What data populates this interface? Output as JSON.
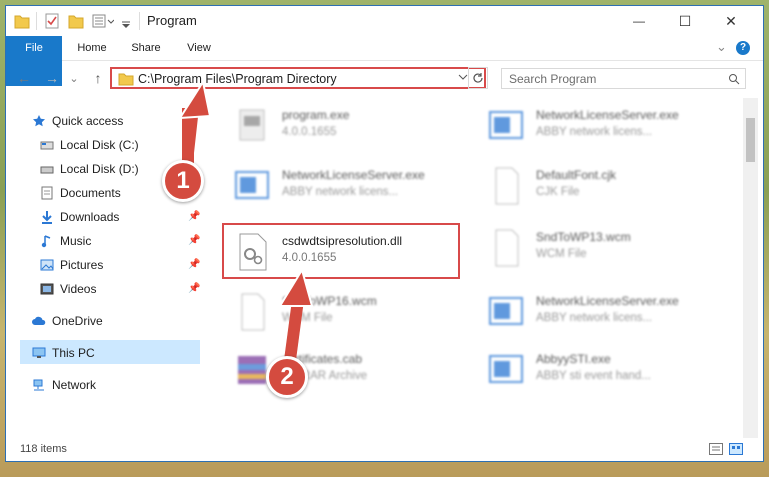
{
  "window": {
    "title": "Program",
    "min_glyph": "—",
    "max_glyph": "☐",
    "close_glyph": "✕"
  },
  "ribbon": {
    "tabs": [
      "File",
      "Home",
      "Share",
      "View"
    ],
    "expand_glyph": "⌄",
    "help_glyph": "?"
  },
  "nav_bar": {
    "back_glyph": "←",
    "forward_glyph": "→",
    "recent_glyph": "⌄",
    "up_glyph": "↑",
    "address": "C:\\Program Files\\Program Directory",
    "search_placeholder": "Search Program"
  },
  "sidebar": {
    "items": [
      {
        "label": "Quick access",
        "icon": "star-icon"
      },
      {
        "label": "Local Disk (C:)",
        "icon": "drive-icon"
      },
      {
        "label": "Local Disk (D:)",
        "icon": "drive-icon"
      },
      {
        "label": "Documents",
        "icon": "document-icon",
        "pinned": true
      },
      {
        "label": "Downloads",
        "icon": "download-icon",
        "pinned": true
      },
      {
        "label": "Music",
        "icon": "music-icon",
        "pinned": true
      },
      {
        "label": "Pictures",
        "icon": "picture-icon",
        "pinned": true
      },
      {
        "label": "Videos",
        "icon": "video-icon",
        "pinned": true
      },
      {
        "label": "OneDrive",
        "icon": "cloud-icon"
      },
      {
        "label": "This PC",
        "icon": "computer-icon",
        "selected": true
      },
      {
        "label": "Network",
        "icon": "network-icon"
      }
    ]
  },
  "files": {
    "left": [
      {
        "name": "program.exe",
        "meta": "4.0.0.1655"
      },
      {
        "name": "NetworkLicenseServer.exe",
        "meta": "ABBY network licens..."
      },
      {
        "name": "csdwdtsipresolution.dll",
        "meta": "4.0.0.1655"
      },
      {
        "name": "SndToWP16.wcm",
        "meta": "WCM File"
      },
      {
        "name": "certificates.cab",
        "meta": "WinRAR Archive"
      }
    ],
    "right": [
      {
        "name": "NetworkLicenseServer.exe",
        "meta": "ABBY network licens..."
      },
      {
        "name": "DefaultFont.cjk",
        "meta": "CJK File"
      },
      {
        "name": "SndToWP13.wcm",
        "meta": "WCM File"
      },
      {
        "name": "NetworkLicenseServer.exe",
        "meta": "ABBY network licens..."
      },
      {
        "name": "AbbyySTI.exe",
        "meta": "ABBY sti event hand..."
      }
    ]
  },
  "status": {
    "item_count": "118 items"
  },
  "callouts": [
    "1",
    "2"
  ],
  "colors": {
    "accent": "#1979ca",
    "highlight": "#d84a4a",
    "selection": "#cce8ff"
  }
}
